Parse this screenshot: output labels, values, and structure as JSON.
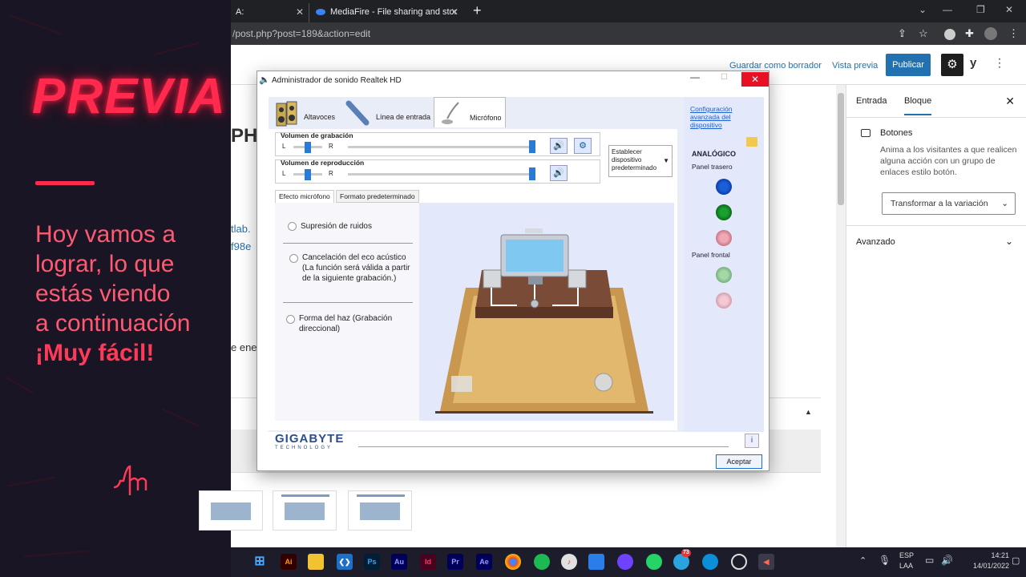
{
  "promo": {
    "title": "PREVIA",
    "line1": "Hoy vamos a",
    "line2": "lograr, lo que",
    "line3": "estás viendo",
    "line4": "a continuación",
    "line5": "¡Muy fácil!",
    "accent": "#ff2a4d"
  },
  "browser": {
    "tabs": [
      {
        "label": "A: ACTUALIZACIÓN",
        "close": "✕"
      },
      {
        "label": "MediaFire - File sharing and stor",
        "close": "✕"
      }
    ],
    "new_tab": "+",
    "url": "/post.php?post=189&action=edit"
  },
  "wp": {
    "save_draft": "Guardar como borrador",
    "preview": "Vista previa",
    "publish": "Publicar",
    "yoast": "y",
    "more": "⋮",
    "accent": "#2271b1",
    "fragments": {
      "heading": "PH",
      "link1": "tlab.",
      "link2": "f98e",
      "text1": "e ene"
    },
    "sidebar": {
      "tab_entrada": "Entrada",
      "tab_bloque": "Bloque",
      "close": "✕",
      "block_title": "Botones",
      "block_desc": "Anima a los visitantes a que realicen alguna acción con un grupo de enlaces estilo botón.",
      "transform": "Transformar a la variación",
      "advanced": "Avanzado"
    }
  },
  "realtek": {
    "title": "Administrador de sonido Realtek HD",
    "tabs": {
      "speakers": "Altavoces",
      "line_in": "Línea de entrada",
      "mic": "Micrófono"
    },
    "rec_volume": "Volumen de grabación",
    "play_volume": "Volumen de reproducción",
    "L": "L",
    "R": "R",
    "set_default": "Establecer dispositivo predeterminado",
    "subtab_effect": "Efecto micrófono",
    "subtab_format": "Formato predeterminado",
    "noise": "Supresión de ruidos",
    "echo": "Cancelación del eco acústico (La función será válida a partir de la siguiente grabación.)",
    "beam": "Forma del haz (Grabación direccional)",
    "advanced_config": "Configuración avanzada del dispositivo",
    "analog": "ANALÓGICO",
    "rear_panel": "Panel trasero",
    "front_panel": "Panel frontal",
    "brand": "GIGABYTE",
    "brand_sub": "TECHNOLOGY",
    "ok": "Aceptar",
    "jack_colors": {
      "rear": [
        "#0b3fa8",
        "#0d7a1c",
        "#d88a9a"
      ],
      "front": [
        "#7fbf85",
        "#e8a8b8"
      ]
    }
  },
  "taskbar": {
    "apps": [
      "Ai",
      "Ps",
      "Au",
      "Id",
      "Pr",
      "Ae"
    ],
    "lang1": "ESP",
    "lang2": "LAA",
    "time": "14:21",
    "date": "14/01/2022",
    "badge": "73"
  }
}
